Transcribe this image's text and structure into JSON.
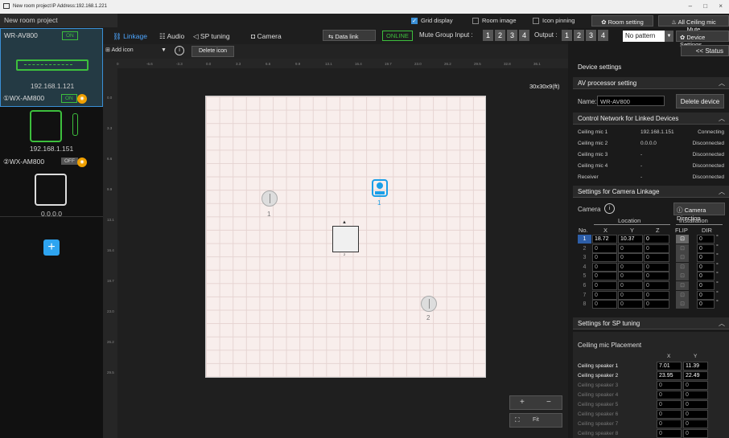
{
  "window": {
    "title": "New room project",
    "ip_address": "IP Address:192.168.1.221",
    "min": "–",
    "restore": "□",
    "close": "×"
  },
  "project": {
    "name": "New room project"
  },
  "top_options": {
    "grid_display": "Grid display",
    "room_image": "Room image",
    "icon_pinning": "Icon pinning",
    "room_setting": "Room setting",
    "all_ceiling_mic_mute": "All Ceiling mic Mute"
  },
  "devices": [
    {
      "name": "WR-AV800",
      "status": "ON",
      "ip": "192.168.1.121"
    },
    {
      "name": "①WX-AM800",
      "status": "ON",
      "ip": "192.168.1.151"
    },
    {
      "name": "②WX-AM800",
      "status": "OFF",
      "ip": "0.0.0.0"
    }
  ],
  "add_device": "+",
  "tabs": {
    "linkage": "Linkage",
    "audio": "Audio",
    "sp_tuning": "SP tuning",
    "camera": "Camera"
  },
  "data_link": "Data link",
  "online": "ONLINE",
  "mute_group": {
    "label": "Mute Group Input :",
    "inputs": [
      "1",
      "2",
      "3",
      "4"
    ],
    "output_label": "Output :",
    "outputs": [
      "1",
      "2",
      "3",
      "4"
    ],
    "pattern": "No pattern"
  },
  "device_settings_btn": "Device Settings",
  "status_btn": "<< Status",
  "toolbar": {
    "add_icon": "Add icon",
    "delete_icon": "Delete icon"
  },
  "ruler": {
    "h": [
      "0",
      "-6.6",
      "-3.3",
      "0.0",
      "3.3",
      "6.6",
      "9.9",
      "13.1",
      "16.4",
      "19.7",
      "23.0",
      "26.2",
      "29.5",
      "32.8",
      "36.1"
    ],
    "v": [
      "0.0",
      "3.3",
      "6.6",
      "9.9",
      "13.1",
      "16.4",
      "19.7",
      "23.0",
      "26.2",
      "29.5"
    ]
  },
  "canvas": {
    "room_size": "30x30x9(ft)",
    "mic1": "1",
    "mic2": "2",
    "camera": "1",
    "processor": "2",
    "zoom_in": "+",
    "zoom_out": "−",
    "fit": "Fit"
  },
  "panel": {
    "title": "Device settings",
    "av_section": "AV processor setting",
    "name_label": "Name:",
    "name_value": "WR-AV800",
    "delete_device": "Delete device",
    "control_section": "Control Network for Linked Devices",
    "control_rows": [
      {
        "name": "Ceiling mic 1",
        "ip": "192.168.1.151",
        "status": "Connecting"
      },
      {
        "name": "Ceiling mic 2",
        "ip": "0.0.0.0",
        "status": "Disconnected"
      },
      {
        "name": "Ceiling mic 3",
        "ip": "-",
        "status": "Disconnected"
      },
      {
        "name": "Ceiling mic 4",
        "ip": "-",
        "status": "Disconnected"
      },
      {
        "name": "Receiver",
        "ip": "-",
        "status": "Disconnected"
      }
    ],
    "camera_section": "Settings for Camera Linkage",
    "camera_label": "Camera",
    "camera_direction": "Camera Direction",
    "cam_headers": {
      "location": "Location",
      "installation": "Installation",
      "no": "No.",
      "x": "X",
      "y": "Y",
      "z": "Z",
      "flip": "FLIP",
      "dir": "DIR"
    },
    "cam_rows": [
      {
        "no": "1",
        "x": "18.72",
        "y": "10.37",
        "z": "0",
        "dir": "0"
      },
      {
        "no": "2",
        "x": "0",
        "y": "0",
        "z": "0",
        "dir": "0"
      },
      {
        "no": "3",
        "x": "0",
        "y": "0",
        "z": "0",
        "dir": "0"
      },
      {
        "no": "4",
        "x": "0",
        "y": "0",
        "z": "0",
        "dir": "0"
      },
      {
        "no": "5",
        "x": "0",
        "y": "0",
        "z": "0",
        "dir": "0"
      },
      {
        "no": "6",
        "x": "0",
        "y": "0",
        "z": "0",
        "dir": "0"
      },
      {
        "no": "7",
        "x": "0",
        "y": "0",
        "z": "0",
        "dir": "0"
      },
      {
        "no": "8",
        "x": "0",
        "y": "0",
        "z": "0",
        "dir": "0"
      }
    ],
    "deg": "°",
    "sp_section": "Settings for SP tuning",
    "mic_placement": "Ceiling mic Placement",
    "sp_x": "X",
    "sp_y": "Y",
    "speakers": [
      {
        "name": "Ceiling speaker 1",
        "x": "7.01",
        "y": "11.39"
      },
      {
        "name": "Ceiling speaker 2",
        "x": "23.95",
        "y": "22.49"
      },
      {
        "name": "Ceiling speaker 3",
        "x": "0",
        "y": "0"
      },
      {
        "name": "Ceiling speaker 4",
        "x": "0",
        "y": "0"
      },
      {
        "name": "Ceiling speaker 5",
        "x": "0",
        "y": "0"
      },
      {
        "name": "Ceiling speaker 6",
        "x": "0",
        "y": "0"
      },
      {
        "name": "Ceiling speaker 7",
        "x": "0",
        "y": "0"
      },
      {
        "name": "Ceiling speaker 8",
        "x": "0",
        "y": "0"
      }
    ]
  }
}
